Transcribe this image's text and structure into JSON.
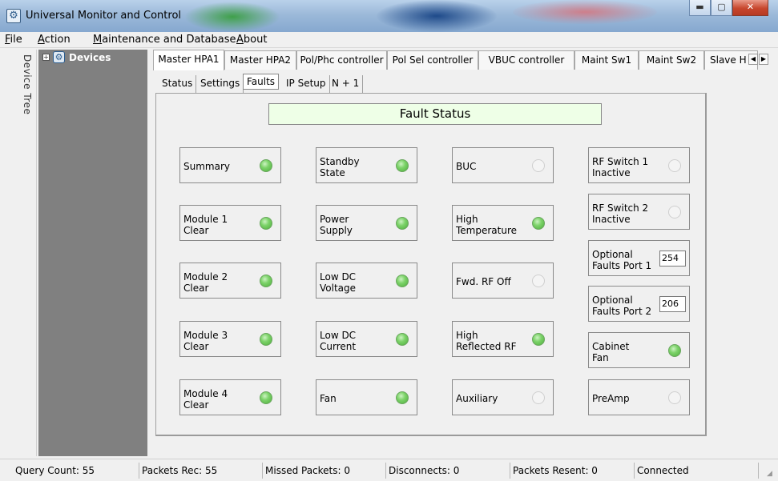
{
  "window": {
    "title": "Universal Monitor and Control",
    "app_icon": "globe-gear-icon"
  },
  "menu": {
    "items": [
      {
        "label": "File",
        "mnemonic": "F",
        "rest": "ile"
      },
      {
        "label": "Action",
        "mnemonic": "A",
        "rest": "ction"
      },
      {
        "label": "Maintenance and Database",
        "mnemonic": "M",
        "rest": "aintenance and Database"
      },
      {
        "label": "About",
        "mnemonic": "A",
        "rest": "bout"
      }
    ]
  },
  "left_strip": {
    "label": "Device Tree",
    "collapse": "«"
  },
  "tree": {
    "root_label": "Devices",
    "expander": "+"
  },
  "device_tabs": [
    "Master HPA1",
    "Master HPA2",
    "Pol/Phc controller",
    "Pol Sel controller",
    "VBUC controller",
    "Maint Sw1",
    "Maint Sw2",
    "Slave H"
  ],
  "active_device_tab": "Master HPA1",
  "sub_tabs": [
    "Status",
    "Settings",
    "Faults",
    "IP Setup",
    "N + 1"
  ],
  "active_sub_tab": "Faults",
  "fault_header": "Fault Status",
  "faults": [
    {
      "label": "Summary",
      "state": "on"
    },
    {
      "label": "Module 1 Clear",
      "line1": "Module 1",
      "line2": "Clear",
      "state": "on"
    },
    {
      "label": "Module 2 Clear",
      "line1": "Module 2",
      "line2": "Clear",
      "state": "on"
    },
    {
      "label": "Module 3 Clear",
      "line1": "Module 3",
      "line2": "Clear",
      "state": "on"
    },
    {
      "label": "Module 4 Clear",
      "line1": "Module 4",
      "line2": "Clear",
      "state": "on"
    },
    {
      "label": "Standby State",
      "line1": "Standby",
      "line2": "State",
      "state": "on"
    },
    {
      "label": "Power Supply",
      "line1": "Power",
      "line2": "Supply",
      "state": "on"
    },
    {
      "label": "Low DC Voltage",
      "line1": "Low DC",
      "line2": "Voltage",
      "state": "on"
    },
    {
      "label": "Low DC Current",
      "line1": "Low DC",
      "line2": "Current",
      "state": "on"
    },
    {
      "label": "Fan",
      "state": "on"
    },
    {
      "label": "BUC",
      "state": "off"
    },
    {
      "label": "High Temperature",
      "line1": "High",
      "line2": "Temperature",
      "state": "on"
    },
    {
      "label": "Fwd. RF Off",
      "state": "off"
    },
    {
      "label": "High Reflected RF",
      "line1": "High",
      "line2": "Reflected RF",
      "state": "on"
    },
    {
      "label": "Auxiliary",
      "state": "off"
    },
    {
      "label": "RF Switch 1 Inactive",
      "line1": "RF Switch 1",
      "line2": "Inactive",
      "state": "off"
    },
    {
      "label": "RF Switch 2 Inactive",
      "line1": "RF Switch 2",
      "line2": "Inactive",
      "state": "off"
    },
    {
      "label": "Optional Faults Port 1",
      "line1": "Optional",
      "line2": "Faults Port 1",
      "value": "254"
    },
    {
      "label": "Optional Faults Port 2",
      "line1": "Optional",
      "line2": "Faults Port 2",
      "value": "206"
    },
    {
      "label": "Cabinet Fan",
      "line1": "Cabinet",
      "line2": "Fan",
      "state": "on"
    },
    {
      "label": "PreAmp",
      "state": "off"
    }
  ],
  "status_bar": {
    "query_count": "Query Count: 55",
    "packets_rec": "Packets Rec: 55",
    "missed_packets": "Missed Packets: 0",
    "disconnects": "Disconnects: 0",
    "packets_resent": "Packets Resent: 0",
    "connection": "Connected"
  },
  "colors": {
    "led_on": "#7dd36a",
    "led_off": "#f4f4f4",
    "header_bg": "#eeffe7",
    "tree_bg": "#808080"
  }
}
